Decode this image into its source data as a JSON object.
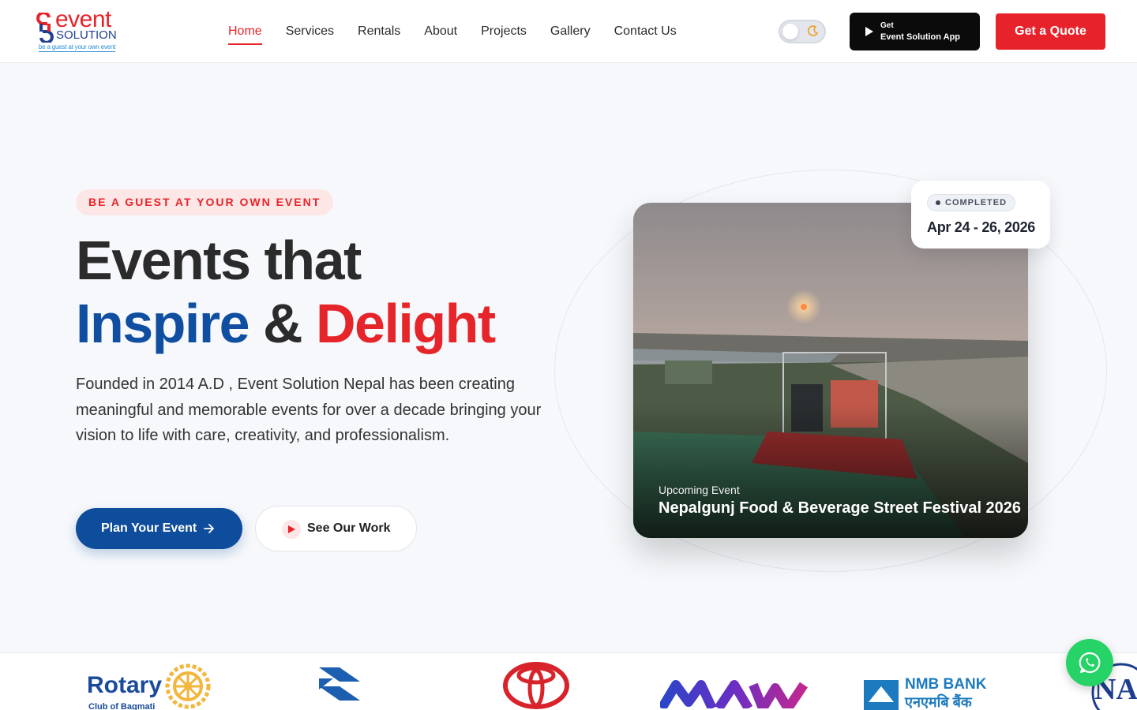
{
  "brand": {
    "logo_word1": "event",
    "logo_word2": "SOLUTION",
    "tagline": "be a guest at your own event",
    "colors": {
      "red": "#e5252a",
      "blue": "#0f4ea1",
      "dark": "#2b2b2b"
    }
  },
  "nav": {
    "items": [
      {
        "label": "Home",
        "active": true
      },
      {
        "label": "Services"
      },
      {
        "label": "Rentals"
      },
      {
        "label": "About"
      },
      {
        "label": "Projects"
      },
      {
        "label": "Gallery"
      },
      {
        "label": "Contact Us"
      }
    ]
  },
  "header": {
    "theme_toggle_icon": "moon-icon",
    "app_button_line1": "Get",
    "app_button_line2": "Event Solution App",
    "quote_button": "Get a Quote"
  },
  "hero": {
    "badge": "BE A GUEST AT YOUR OWN EVENT",
    "headline_line1": "Events that",
    "headline_blue": "Inspire",
    "headline_amp": "&",
    "headline_red": "Delight",
    "description": "Founded in 2014 A.D , Event Solution Nepal has been creating meaningful and memorable events for over a decade bringing your vision to life with care, creativity, and professionalism.",
    "primary_button": "Plan Your Event",
    "secondary_button": "See Our Work"
  },
  "event_card": {
    "label": "Upcoming Event",
    "title": "Nepalgunj Food & Beverage Street Festival 2026",
    "status": "COMPLETED",
    "dates": "Apr 24 - 26, 2026"
  },
  "partners": {
    "rotary_name": "Rotary",
    "rotary_sub": "Club of Bagmati",
    "nmb_name": "NMB BANK",
    "nmb_sub": "एनएमबि बैंक",
    "nmb_badge": "NMB",
    "nac_partial": "NA",
    "logos": [
      "rotary-logo",
      "bajaj-logo",
      "toyota-logo",
      "maw-logo",
      "nmb-bank-logo",
      "nac-logo"
    ]
  },
  "floating": {
    "whatsapp_icon": "whatsapp-icon"
  }
}
